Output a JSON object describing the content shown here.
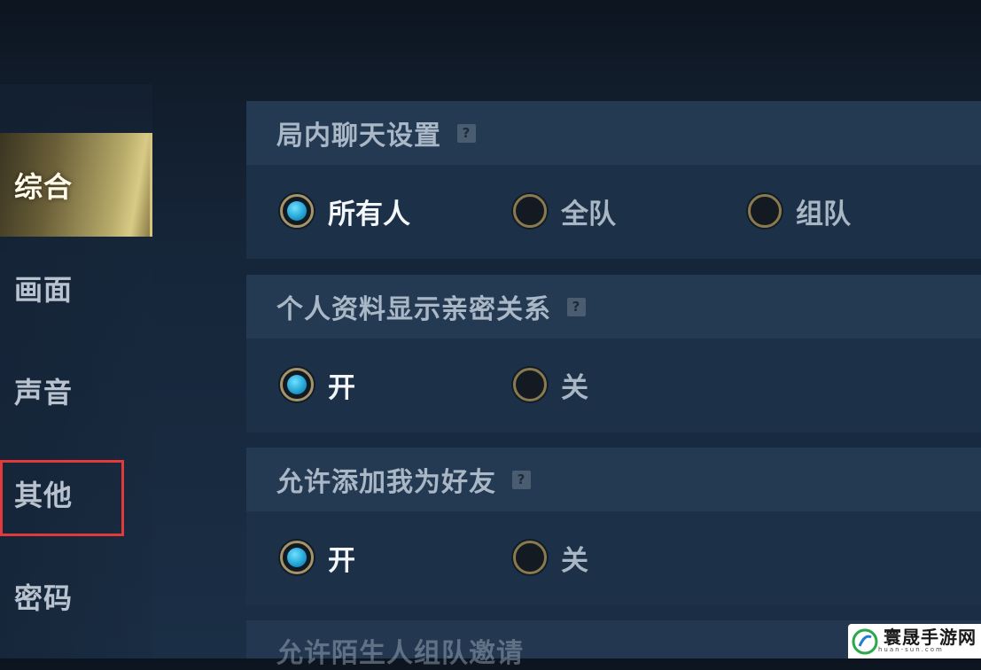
{
  "sidebar": {
    "items": [
      {
        "label": "综合",
        "active": true
      },
      {
        "label": "画面",
        "active": false
      },
      {
        "label": "声音",
        "active": false
      },
      {
        "label": "其他",
        "active": false,
        "highlighted": true
      },
      {
        "label": "密码",
        "active": false
      }
    ]
  },
  "sections": [
    {
      "title": "局内聊天设置",
      "help_icon": "question-mark",
      "options": [
        {
          "label": "所有人",
          "selected": true
        },
        {
          "label": "全队",
          "selected": false
        },
        {
          "label": "组队",
          "selected": false
        }
      ]
    },
    {
      "title": "个人资料显示亲密关系",
      "help_icon": "question-mark",
      "options": [
        {
          "label": "开",
          "selected": true
        },
        {
          "label": "关",
          "selected": false
        }
      ]
    },
    {
      "title": "允许添加我为好友",
      "help_icon": "question-mark",
      "options": [
        {
          "label": "开",
          "selected": true
        },
        {
          "label": "关",
          "selected": false
        }
      ]
    },
    {
      "title": "允许陌生人组队邀请"
    }
  ],
  "help_glyph": "?",
  "watermark": {
    "name": "寰晟手游网",
    "url": "huan-sun.com"
  },
  "colors": {
    "accent_gold": "#d4c680",
    "radio_selected": "#25a6d6",
    "highlight_red": "#e23a3a"
  }
}
